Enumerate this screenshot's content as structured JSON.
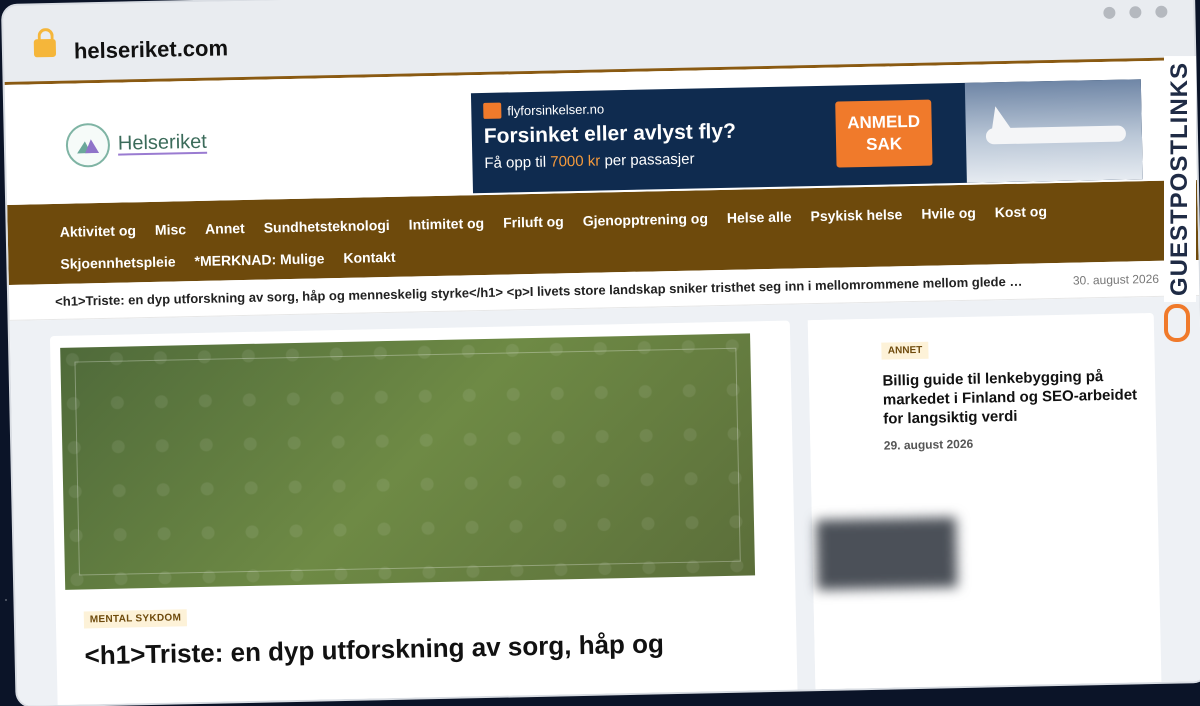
{
  "browser": {
    "url": "helseriket.com"
  },
  "logo": {
    "text": "Helseriket"
  },
  "ad": {
    "brand": "flyforsinkelser.no",
    "title": "Forsinket eller avlyst fly?",
    "sub_prefix": "Få opp til",
    "sub_amount": "7000 kr",
    "sub_suffix": "per passasjer",
    "button": "ANMELD SAK"
  },
  "nav": {
    "items": [
      "Aktivitet og",
      "Misc",
      "Annet",
      "Sundhetsteknologi",
      "Intimitet og",
      "Friluft og",
      "Gjenopptrening og",
      "Helse alle",
      "Psykisk helse",
      "Hvile og",
      "Kost og",
      "Skjoennhetspleie",
      "*MERKNAD: Mulige",
      "Kontakt"
    ]
  },
  "ticker": {
    "text": "<h1>Triste: en dyp utforskning av sorg, håp og menneskelig styrke</h1> <p>I livets store landskap sniker tristhet seg inn i mellomrommene mellom glede …",
    "date": "30. august 2026"
  },
  "main": {
    "category": "MENTAL SYKDOM",
    "title": "<h1>Triste: en dyp utforskning av sorg, håp og"
  },
  "side": {
    "category": "ANNET",
    "title": "Billig guide til lenkebygging på markedet i Finland og SEO-arbeidet for langsiktig verdi",
    "date": "29. august 2026"
  },
  "watermark": {
    "text": "GUESTPOSTLINKS"
  }
}
